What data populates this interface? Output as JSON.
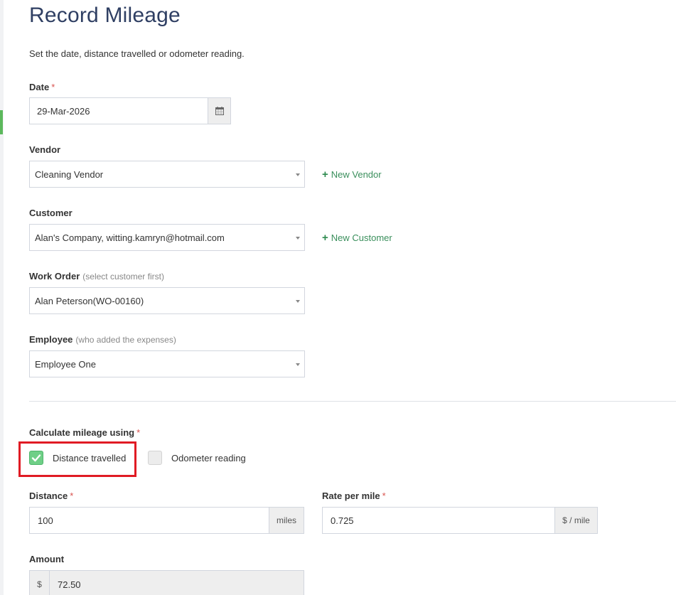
{
  "page": {
    "title": "Record Mileage",
    "intro": "Set the date, distance travelled or odometer reading."
  },
  "date": {
    "label": "Date",
    "required": "*",
    "value": "29-Mar-2026",
    "icon": "calendar-icon"
  },
  "vendor": {
    "label": "Vendor",
    "value": "Cleaning Vendor",
    "new_link": "New Vendor"
  },
  "customer": {
    "label": "Customer",
    "value": "Alan's Company, witting.kamryn@hotmail.com",
    "new_link": "New Customer"
  },
  "work_order": {
    "label": "Work Order",
    "hint": "(select customer first)",
    "value": "Alan Peterson(WO-00160)"
  },
  "employee": {
    "label": "Employee",
    "hint": "(who added the expenses)",
    "value": "Employee One"
  },
  "calc": {
    "label": "Calculate mileage using",
    "required": "*",
    "options": [
      {
        "label": "Distance travelled",
        "checked": true
      },
      {
        "label": "Odometer reading",
        "checked": false
      }
    ]
  },
  "distance": {
    "label": "Distance",
    "required": "*",
    "value": "100",
    "unit": "miles"
  },
  "rate": {
    "label": "Rate per mile",
    "required": "*",
    "value": "0.725",
    "unit": "$ / mile"
  },
  "amount": {
    "label": "Amount",
    "currency": "$",
    "value": "72.50"
  },
  "colors": {
    "title": "#2f3f63",
    "accent_green": "#5cb85c",
    "required": "#d9534f",
    "highlight": "#e01b24",
    "link": "#3a8f5c"
  }
}
